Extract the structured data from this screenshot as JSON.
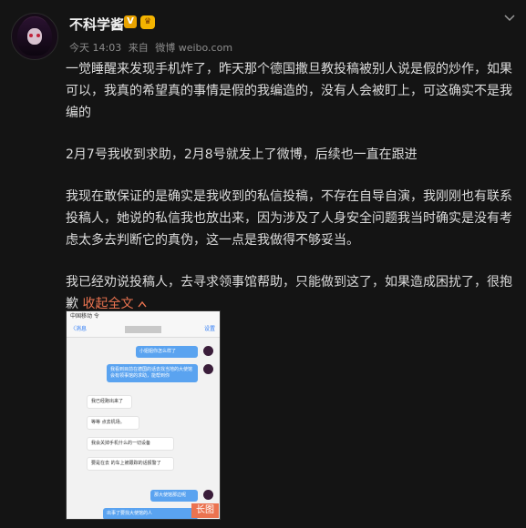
{
  "header": {
    "username": "不科学酱",
    "v_badge": "V",
    "vip_badge": "♛",
    "meta_time": "今天 14:03",
    "meta_from": "来自",
    "meta_source": "微博 weibo.com"
  },
  "post": {
    "paragraphs": [
      "一觉睡醒来发现手机炸了，昨天那个德国撒旦教投稿被别人说是假的炒作，如果可以，我真的希望真的事情是假的我编造的，没有人会被盯上，可这确实不是我编的",
      "2月7号我收到求助，2月8号就发上了微博，后续也一直在跟进",
      "我现在敢保证的是确实是我收到的私信投稿，不存在自导自演，我刚刚也有联系投稿人，她说的私信我也放出来，因为涉及了人身安全问题我当时确实是没有考虑太多去判断它的真伪，这一点是我做得不够妥当。",
      "我已经劝说投稿人，去寻求领事馆帮助，只能做到这了，如果造成困扰了，很抱歉"
    ],
    "collapse_label": "收起全文",
    "collapse_icon": "chevron-up-icon"
  },
  "screenshot": {
    "status": "中国移动 令",
    "back": "〈消息",
    "settings": "设置",
    "messages": [
      {
        "dir": "out",
        "text": "小姐姐你怎么样了"
      },
      {
        "dir": "out",
        "text": "我看到目前在德国的话去找当地的大使馆会有领事馆的求助，能帮到你"
      },
      {
        "dir": "in",
        "text": "我已经跑出来了"
      },
      {
        "dir": "in",
        "text": "等等 点去机场。"
      },
      {
        "dir": "in",
        "text": "我会关掉手机什么的一切设备"
      },
      {
        "dir": "in",
        "text": "要是在去 的车上被跟踪的话报警了"
      },
      {
        "dir": "out",
        "text": "那大使馆那边呢"
      },
      {
        "dir": "out",
        "text": "出事了要找大使馆的人"
      }
    ],
    "long_tag": "长图"
  }
}
